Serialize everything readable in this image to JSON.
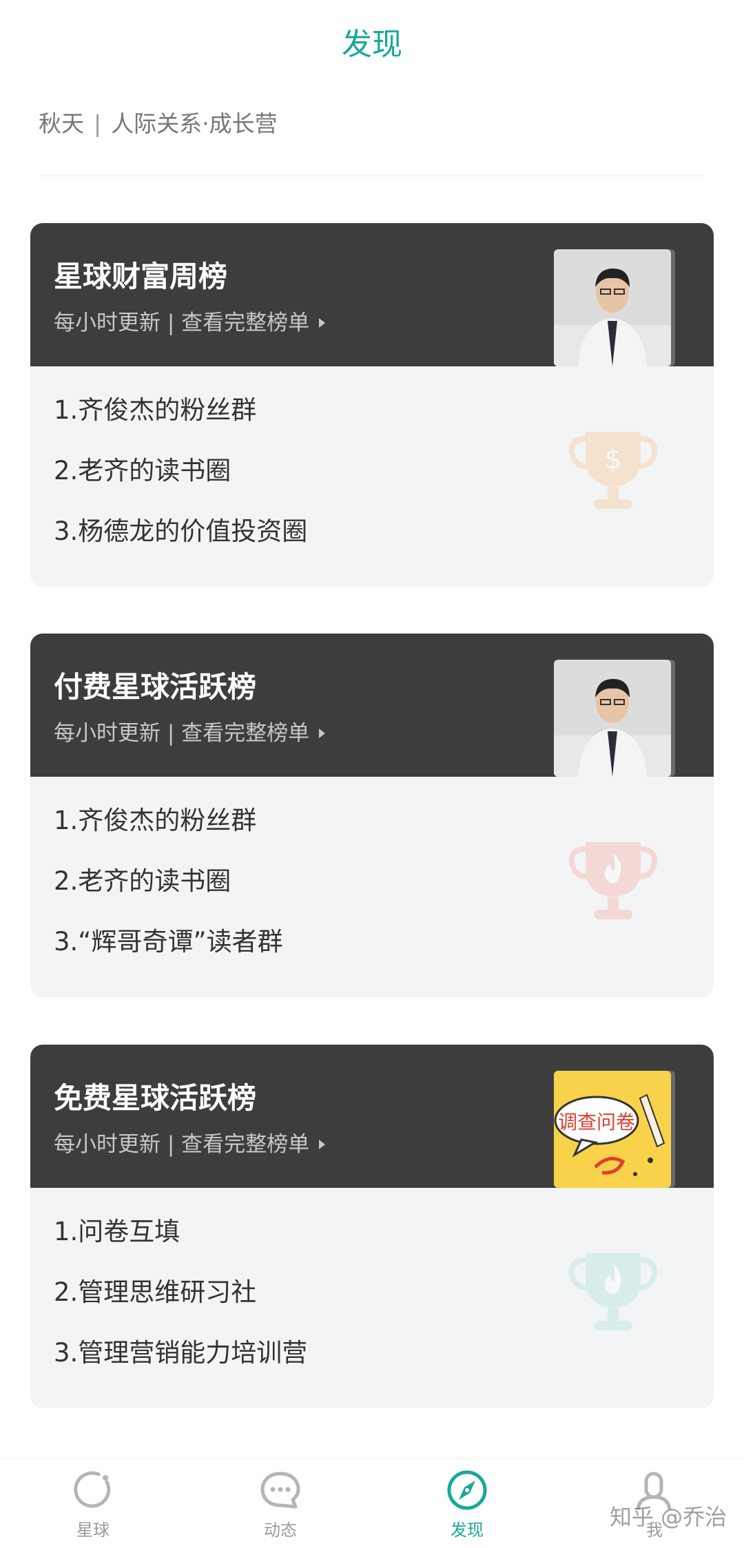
{
  "header": {
    "title": "发现"
  },
  "breadcrumb": {
    "left": "秋天",
    "sep": "|",
    "right": "人际关系·成长营"
  },
  "cards": [
    {
      "title": "星球财富周榜",
      "subtitle": "每小时更新 | 查看完整榜单",
      "items": [
        "1.齐俊杰的粉丝群",
        "2.老齐的读书圈",
        "3.杨德龙的价值投资圈"
      ],
      "trophy_icon": "dollar-trophy-icon",
      "trophy_color": "#f6cda0"
    },
    {
      "title": "付费星球活跃榜",
      "subtitle": "每小时更新 | 查看完整榜单",
      "items": [
        "1.齐俊杰的粉丝群",
        "2.老齐的读书圈",
        "3.“辉哥奇谭”读者群"
      ],
      "trophy_icon": "flame-trophy-icon",
      "trophy_color": "#f6b7b0"
    },
    {
      "title": "免费星球活跃榜",
      "subtitle": "每小时更新 | 查看完整榜单",
      "items": [
        "1.问卷互填",
        "2.管理思维研习社",
        "3.管理营销能力培训营"
      ],
      "thumb_text": "调查问卷",
      "trophy_icon": "flame-trophy-icon",
      "trophy_color": "#b9e6dc"
    }
  ],
  "tabbar": {
    "items": [
      {
        "label": "星球",
        "icon": "planet-icon"
      },
      {
        "label": "动态",
        "icon": "chat-bubble-icon"
      },
      {
        "label": "发现",
        "icon": "compass-icon",
        "active": true
      },
      {
        "label": "我",
        "icon": "person-icon"
      }
    ],
    "accent": "#17a89a"
  },
  "watermark": "知乎 @乔治"
}
